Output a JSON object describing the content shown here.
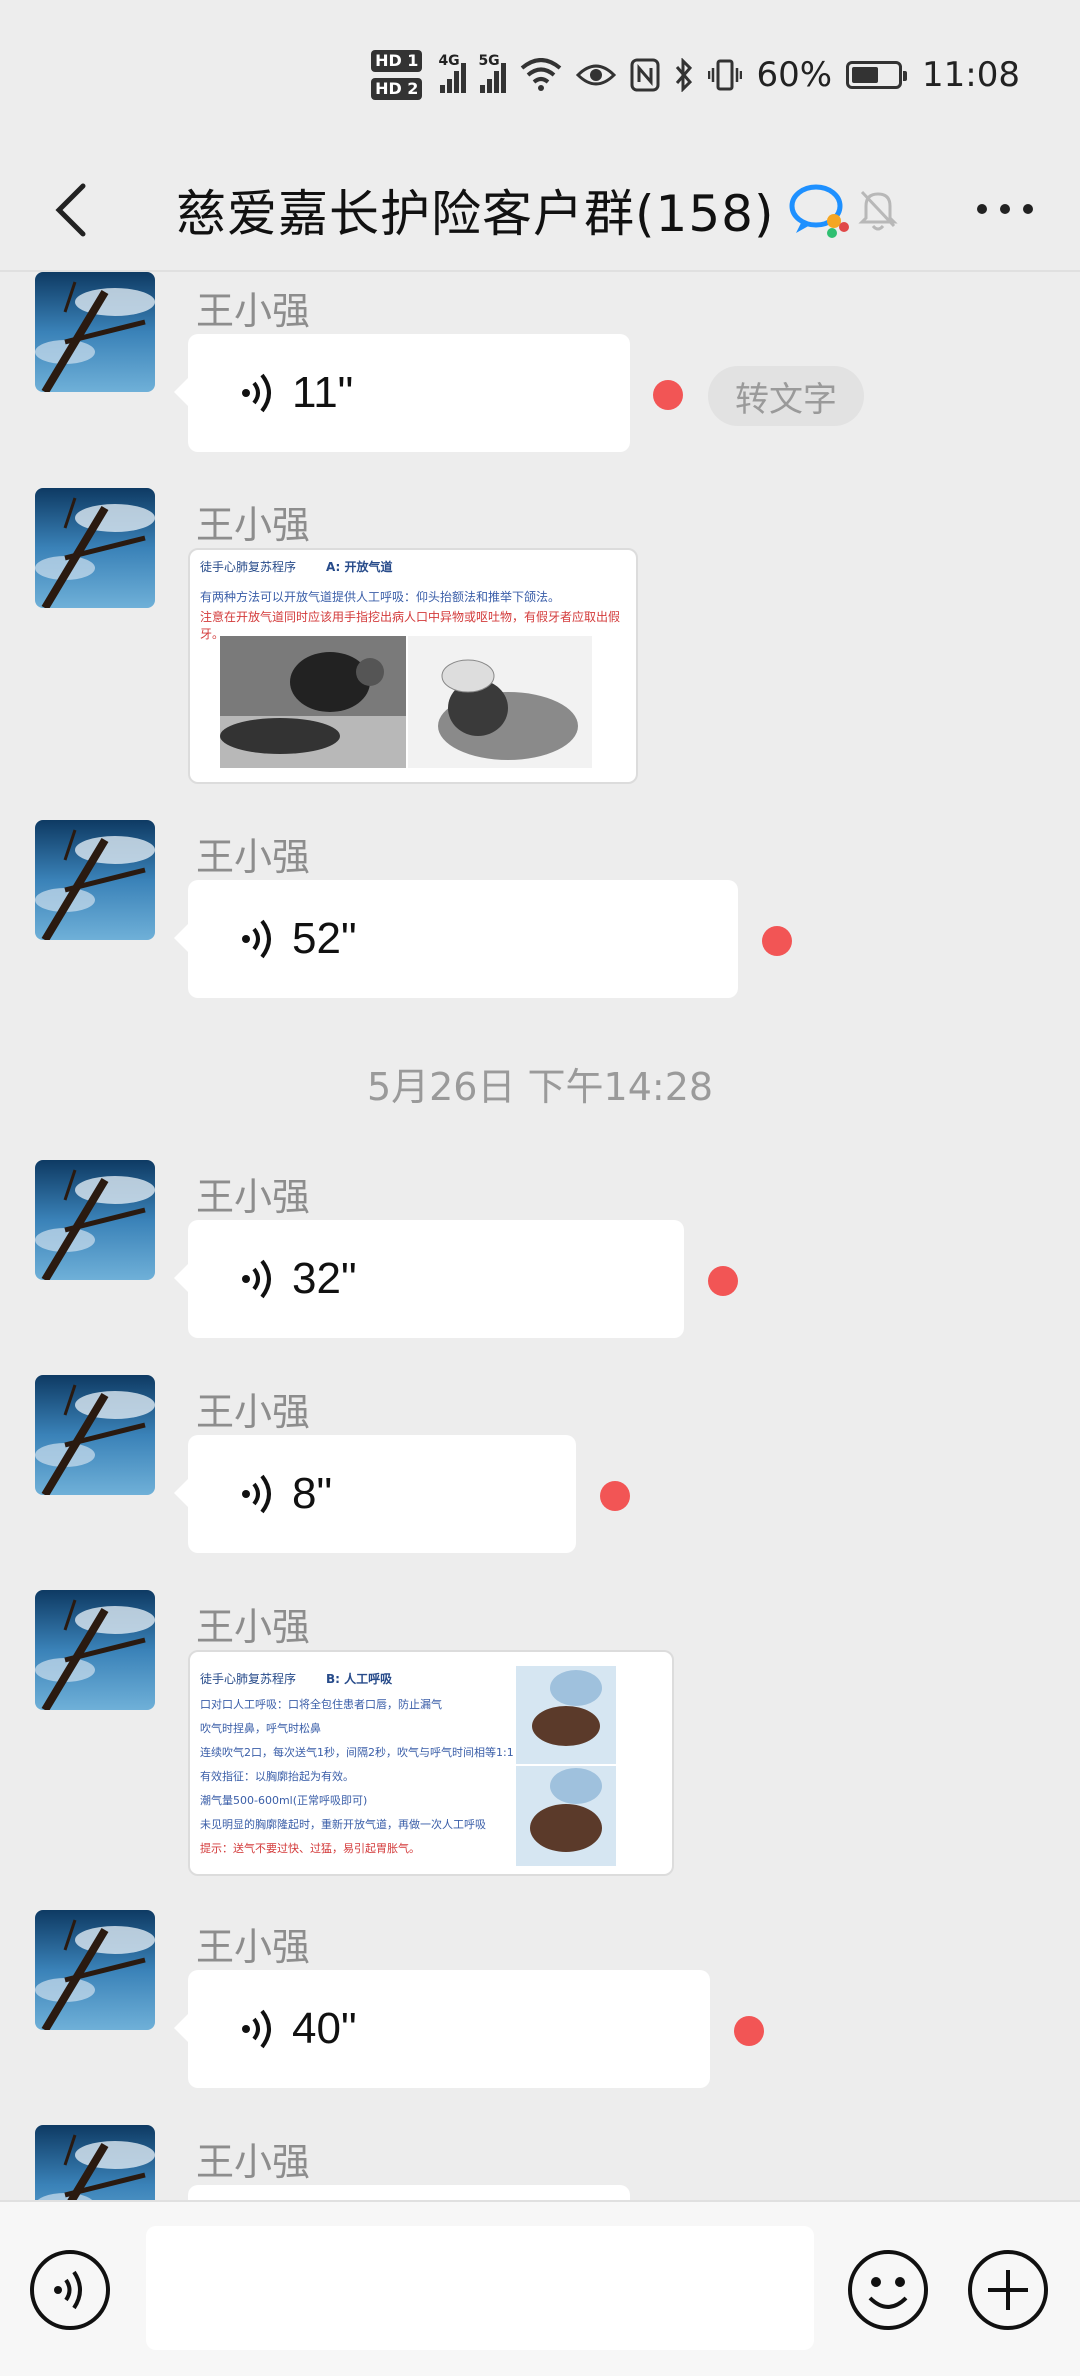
{
  "status_bar": {
    "hd1": "HD 1",
    "hd2": "HD 2",
    "net1": "4G",
    "net2": "5G",
    "battery_text": "60%",
    "battery_level": 0.6,
    "time": "11:08"
  },
  "header": {
    "title": "慈爱嘉长护险客户群(158)",
    "accent_color": "#1e90ff"
  },
  "messages": [
    {
      "sender": "王小强",
      "type": "voice",
      "duration": "11\"",
      "unread": true,
      "to_text_label": "转文字"
    },
    {
      "sender": "王小强",
      "type": "image",
      "image_title": "徒手心肺复苏程序",
      "image_step": "A: 开放气道",
      "image_line1": "有两种方法可以开放气道提供人工呼吸：仰头抬额法和推举下颌法。",
      "image_line2": "注意在开放气道同时应该用手指挖出病人口中异物或呕吐物，有假牙者应取出假牙。"
    },
    {
      "sender": "王小强",
      "type": "voice",
      "duration": "52\"",
      "unread": true
    },
    {
      "sender": "王小强",
      "type": "voice",
      "duration": "32\"",
      "unread": true
    },
    {
      "sender": "王小强",
      "type": "voice",
      "duration": "8\"",
      "unread": true
    },
    {
      "sender": "王小强",
      "type": "image",
      "image_title": "徒手心肺复苏程序",
      "image_step": "B: 人工呼吸",
      "image_lines": [
        "口对口人工呼吸：口将全包住患者口唇，防止漏气",
        "吹气时捏鼻，呼气时松鼻",
        "连续吹气2口，每次送气1秒，间隔2秒，吹气与呼气时间相等1:1",
        "有效指征：以胸廓抬起为有效。",
        "潮气量500-600ml(正常呼吸即可)",
        "未见明显的胸廓隆起时，重新开放气道，再做一次人工呼吸",
        "提示：送气不要过快、过猛，易引起胃胀气。"
      ]
    },
    {
      "sender": "王小强",
      "type": "voice",
      "duration": "40\"",
      "unread": true
    },
    {
      "sender": "王小强",
      "type": "voice",
      "duration": "",
      "unread": false
    }
  ],
  "timestamp": "5月26日 下午14:28",
  "input": {
    "value": "",
    "placeholder": ""
  }
}
